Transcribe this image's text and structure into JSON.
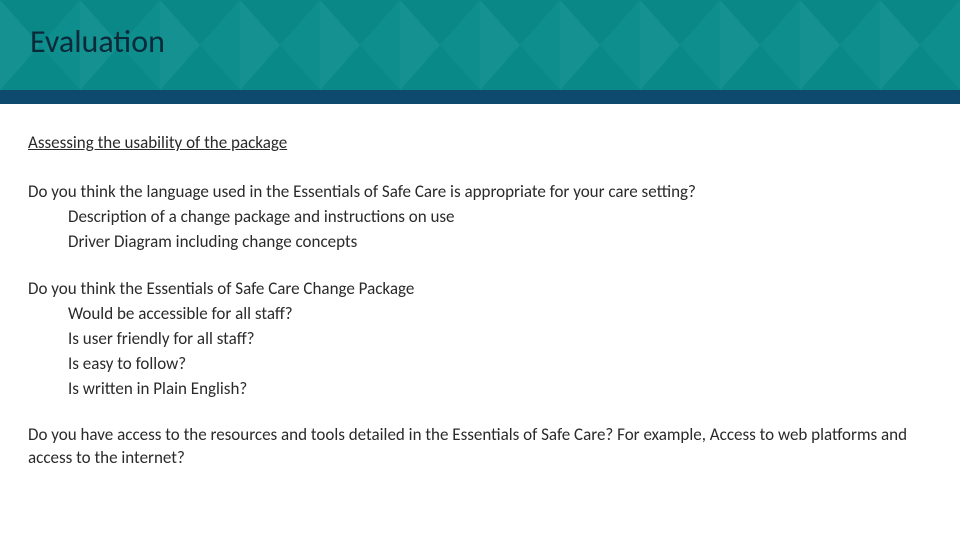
{
  "header": {
    "title": "Evaluation"
  },
  "colors": {
    "header_bg": "#0b8c8c",
    "bar": "#0d4a6e",
    "title_text": "#0a2a3a"
  },
  "content": {
    "section_heading": "Assessing the usability of the package",
    "q1": {
      "text": "Do you think the language used in the Essentials of Safe Care is appropriate for your care setting?",
      "items": [
        "Description of a change package and instructions on use",
        "Driver Diagram including change concepts"
      ]
    },
    "q2": {
      "text": "Do you think the Essentials of Safe Care Change Package",
      "items": [
        "Would be accessible for all staff?",
        "Is user friendly for all staff?",
        "Is easy to follow?",
        "Is written in Plain English?"
      ]
    },
    "q3": {
      "text": "Do you have access to the resources and tools detailed in the Essentials of Safe Care? For example, Access to web platforms and access to the internet?"
    }
  }
}
